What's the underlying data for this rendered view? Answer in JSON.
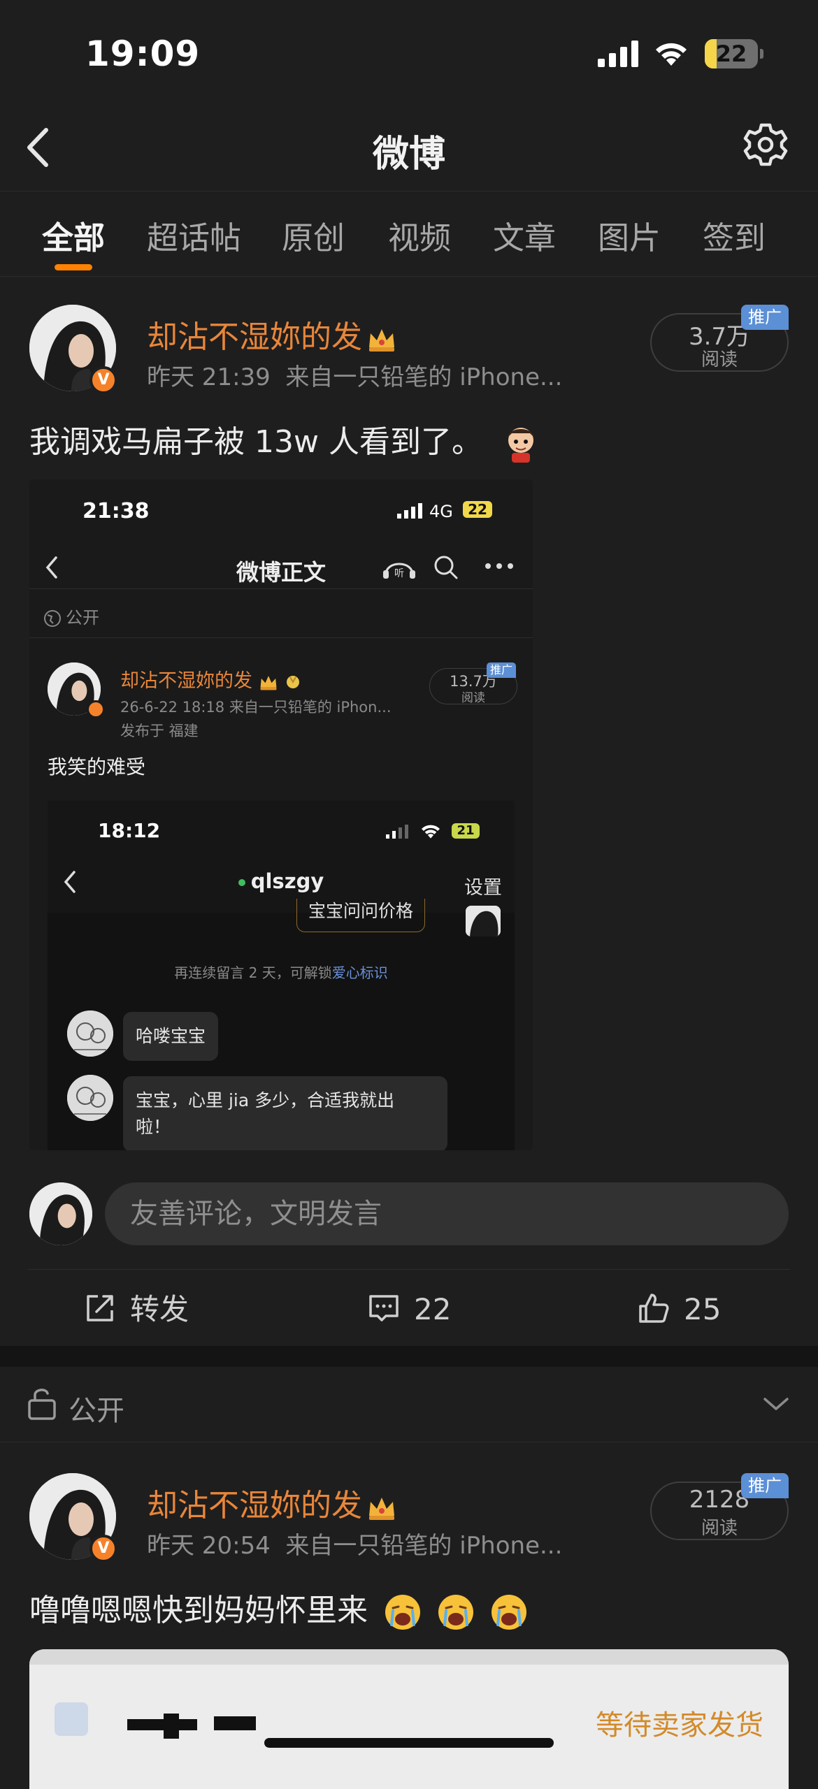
{
  "status_bar": {
    "time": "19:09",
    "battery": "22",
    "battery_level_percent": 22
  },
  "nav": {
    "title": "微博",
    "back_icon": "chevron-left-icon",
    "settings_icon": "gear-icon"
  },
  "tabs": [
    {
      "label": "全部",
      "active": true
    },
    {
      "label": "超话帖",
      "active": false
    },
    {
      "label": "原创",
      "active": false
    },
    {
      "label": "视频",
      "active": false
    },
    {
      "label": "文章",
      "active": false
    },
    {
      "label": "图片",
      "active": false
    },
    {
      "label": "签到",
      "active": false
    }
  ],
  "post1": {
    "username": "却沾不湿妳的发",
    "time": "昨天 21:39",
    "source": "来自一只铅笔的 iPhone...",
    "reads": "3.7万",
    "reads_label": "阅读",
    "promo_tag": "推广",
    "verified_badge": "V",
    "text": "我调戏马扁子被 13w 人看到了。",
    "screenshot": {
      "time": "21:38",
      "network": "4G",
      "battery": "22",
      "title": "微博正文",
      "public_label": "公开",
      "username": "却沾不湿妳的发",
      "meta": "26-6-22 18:18  来自一只铅笔的 iPhon...",
      "location": "发布于 福建",
      "reads": "13.7万",
      "reads_label": "阅读",
      "promo_tag": "推广",
      "text": "我笑的难受",
      "chat": {
        "time": "18:12",
        "battery": "21",
        "contact": "qlszgy",
        "settings": "设置",
        "price_msg": "宝宝问问价格",
        "hint_prefix": "再连续留言 2 天，可解锁",
        "hint_link": "爱心标识",
        "msg1": "哈喽宝宝",
        "msg2_line1": "宝宝，心里 jia 多少，合适我就出",
        "msg2_line2": "啦！"
      }
    },
    "comment_placeholder": "友善评论，文明发言",
    "actions": {
      "repost": "转发",
      "comments": "22",
      "likes": "25"
    }
  },
  "public_row": {
    "label": "公开"
  },
  "post2": {
    "username": "却沾不湿妳的发",
    "time": "昨天 20:54",
    "source": "来自一只铅笔的 iPhone...",
    "reads": "2128",
    "reads_label": "阅读",
    "promo_tag": "推广",
    "verified_badge": "V",
    "text": "噜噜嗯嗯快到妈妈怀里来",
    "order_card": {
      "status": "等待卖家发货"
    }
  }
}
